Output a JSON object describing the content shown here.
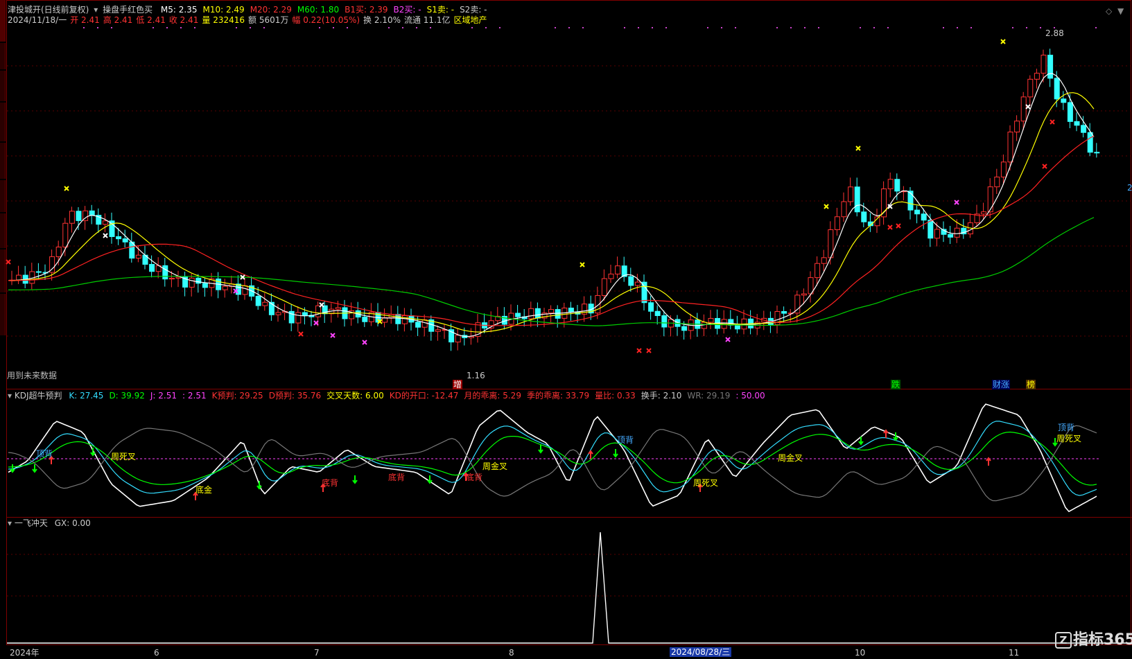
{
  "header": {
    "title": "津投城开(日线前复权)",
    "indicator_name": "操盘手红色买",
    "indicators": [
      {
        "label": "M5: 2.35",
        "color": "#ffffff"
      },
      {
        "label": "M10: 2.49",
        "color": "#ffff00"
      },
      {
        "label": "M20: 2.29",
        "color": "#ff3333"
      },
      {
        "label": "M60: 1.80",
        "color": "#00ff00"
      },
      {
        "label": "B1买: 2.39",
        "color": "#ff3333"
      },
      {
        "label": "B2买: -",
        "color": "#ff44ff"
      },
      {
        "label": "S1卖: -",
        "color": "#ffff00"
      },
      {
        "label": "S2卖: -",
        "color": "#cccccc"
      }
    ],
    "quote": [
      {
        "label": "2024/11/18/一",
        "color": "#cccccc"
      },
      {
        "label": "开 2.41",
        "color": "#ff3333"
      },
      {
        "label": "高 2.41",
        "color": "#ff3333"
      },
      {
        "label": "低 2.41",
        "color": "#ff3333"
      },
      {
        "label": "收 2.41",
        "color": "#ff3333"
      },
      {
        "label": "量 232416",
        "color": "#ffff00"
      },
      {
        "label": "额 5601万",
        "color": "#cccccc"
      },
      {
        "label": "幅 0.22(10.05%)",
        "color": "#ff3333"
      },
      {
        "label": "换 2.10%",
        "color": "#cccccc"
      },
      {
        "label": "流通 11.1亿",
        "color": "#cccccc"
      },
      {
        "label": "区域地产",
        "color": "#ffff00"
      }
    ]
  },
  "main_chart": {
    "high_label": "2.88",
    "low_label": "1.16",
    "future_data_note": "用到未来数据",
    "markers": [
      {
        "text": "增",
        "color": "#ffffff"
      },
      {
        "text": "跌",
        "color": "#00ff00"
      },
      {
        "text": "财涨",
        "color": "#44aaff"
      },
      {
        "text": "榜",
        "color": "#ffff00"
      }
    ],
    "right_tag": "2"
  },
  "kdj": {
    "title": "KDJ超牛预判",
    "values": [
      {
        "label": "K: 27.45",
        "color": "#33ddff"
      },
      {
        "label": "D: 39.92",
        "color": "#00ff00"
      },
      {
        "label": "J: 2.51",
        "color": "#ff44ff"
      },
      {
        "label": ": 2.51",
        "color": "#ff44ff"
      },
      {
        "label": "K预判: 29.25",
        "color": "#ff3333"
      },
      {
        "label": "D预判: 35.76",
        "color": "#ff3333"
      },
      {
        "label": "交叉天数: 6.00",
        "color": "#ffff00"
      },
      {
        "label": "KD的开口: -12.47",
        "color": "#ff3333"
      },
      {
        "label": "月的乖离: 5.29",
        "color": "#ff3333"
      },
      {
        "label": "季的乖离: 33.79",
        "color": "#ff3333"
      },
      {
        "label": "量比: 0.33",
        "color": "#ff3333"
      },
      {
        "label": "换手: 2.10",
        "color": "#cccccc"
      },
      {
        "label": "WR: 29.19",
        "color": "#777777"
      },
      {
        "label": ": 50.00",
        "color": "#ff44ff"
      }
    ],
    "annotations": [
      {
        "text": "顶背",
        "color": "#44aaff"
      },
      {
        "text": "周死叉",
        "color": "#ffff00"
      },
      {
        "text": "底金",
        "color": "#ffff00"
      },
      {
        "text": "底背",
        "color": "#ff3333"
      },
      {
        "text": "底背",
        "color": "#ff3333"
      },
      {
        "text": "底背",
        "color": "#ff3333"
      },
      {
        "text": "周金叉",
        "color": "#ffff00"
      },
      {
        "text": "顶背",
        "color": "#44aaff"
      },
      {
        "text": "周死叉",
        "color": "#ffff00"
      },
      {
        "text": "周金叉",
        "color": "#ffff00"
      },
      {
        "text": "顶背",
        "color": "#44aaff"
      },
      {
        "text": "周死叉",
        "color": "#ffff00"
      }
    ]
  },
  "yfct": {
    "title": "一飞冲天",
    "value": "GX: 0.00"
  },
  "x_axis": {
    "labels": [
      "2024年",
      "6",
      "7",
      "8",
      "2024/08/28/三",
      "10",
      "11"
    ]
  },
  "watermark": "指标365"
}
